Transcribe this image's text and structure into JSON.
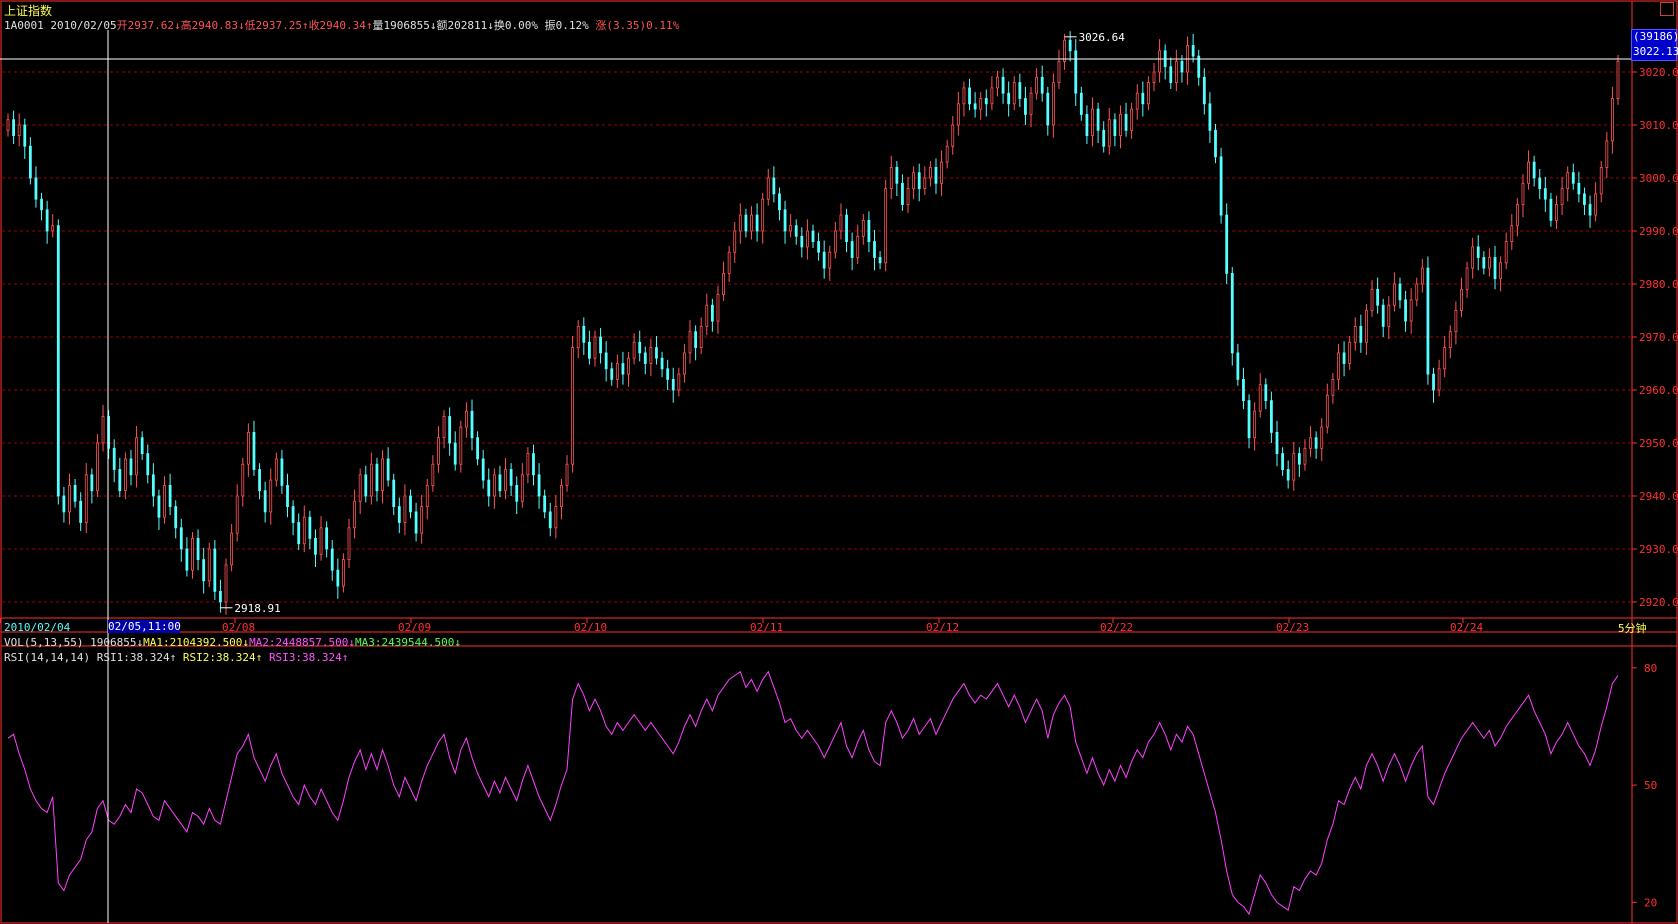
{
  "header": {
    "title": "上证指数",
    "code": "1A0001",
    "date": "2010/02/05",
    "open": "开2937.62↓",
    "high": "高2940.83↓",
    "low": "低2937.25↑",
    "close": "收2940.34↑",
    "volume": "量1906855↓",
    "amount": "额202811↓",
    "turnover": "换0.00%",
    "amplitude": "振0.12%",
    "change": "涨(3.35)0.11%"
  },
  "volume_indicator": {
    "label": "VOL(5,13,55)",
    "value": "1906855↓",
    "ma1": "MA1:2104392.500↓",
    "ma2": "MA2:2448857.500↓",
    "ma3": "MA3:2439544.500↓"
  },
  "rsi_indicator": {
    "label": "RSI(14,14,14)",
    "rsi1": "RSI1:38.324↑",
    "rsi2": "RSI2:38.324↑",
    "rsi3": "RSI3:38.324↑"
  },
  "cursor_label": "02/05,11:00",
  "timeframe": "5分钟",
  "price_tag": {
    "count": "(39186)",
    "price": "3022.13"
  },
  "colors": {
    "up": "#ff5454",
    "down": "#54ffff",
    "grid": "#a00000",
    "axis": "#ff3030",
    "rsi": "#ff40ff",
    "crosshair": "#ffffff",
    "label": "#ffffff"
  },
  "chart_data": [
    {
      "type": "candlestick",
      "title": "",
      "xlabel": "",
      "ylabel": "",
      "ylim": [
        2916,
        3029
      ],
      "yticks": [
        2920.0,
        2930.0,
        2940.0,
        2950.0,
        2960.0,
        2970.0,
        2980.0,
        2990.0,
        3000.0,
        3010.0,
        3020.0
      ],
      "date_labels": [
        "2010/02/04",
        "02/08",
        "02/09",
        "02/10",
        "02/11",
        "02/12",
        "02/22",
        "02/23",
        "02/24"
      ],
      "annotations": [
        {
          "text": "3026.64",
          "value": 3026.64
        },
        {
          "text": "2918.91",
          "value": 2918.91
        }
      ],
      "close": [
        3011,
        3008,
        3010,
        3006,
        3000,
        2996,
        2994,
        2990,
        2991,
        2940,
        2937,
        2942,
        2939,
        2935,
        2944,
        2941,
        2950,
        2955,
        2949,
        2945,
        2941,
        2947,
        2944,
        2951,
        2948,
        2944,
        2940,
        2936,
        2942,
        2938,
        2934,
        2930,
        2926,
        2932,
        2928,
        2924,
        2930,
        2922,
        2920,
        2927,
        2933,
        2940,
        2946,
        2952,
        2945,
        2941,
        2937,
        2943,
        2947,
        2942,
        2938,
        2935,
        2931,
        2936,
        2932,
        2929,
        2934,
        2930,
        2926,
        2923,
        2928,
        2934,
        2939,
        2944,
        2940,
        2946,
        2941,
        2947,
        2943,
        2938,
        2935,
        2940,
        2937,
        2933,
        2938,
        2942,
        2946,
        2951,
        2955,
        2950,
        2946,
        2953,
        2956,
        2951,
        2947,
        2943,
        2940,
        2944,
        2941,
        2945,
        2942,
        2939,
        2944,
        2948,
        2944,
        2940,
        2937,
        2934,
        2938,
        2942,
        2946,
        2968,
        2972,
        2969,
        2966,
        2970,
        2967,
        2964,
        2962,
        2965,
        2963,
        2966,
        2969,
        2967,
        2965,
        2968,
        2966,
        2964,
        2962,
        2960,
        2963,
        2967,
        2971,
        2968,
        2972,
        2976,
        2973,
        2978,
        2982,
        2986,
        2990,
        2993,
        2990,
        2993,
        2990,
        2996,
        3000,
        2997,
        2994,
        2990,
        2991,
        2989,
        2987,
        2990,
        2988,
        2986,
        2983,
        2986,
        2990,
        2993,
        2988,
        2985,
        2989,
        2992,
        2988,
        2985,
        2984,
        2998,
        3002,
        2999,
        2995,
        2998,
        3001,
        2998,
        3000,
        3002,
        2999,
        3003,
        3006,
        3010,
        3014,
        3017,
        3014,
        3013,
        3015,
        3014,
        3017,
        3019,
        3016,
        3014,
        3018,
        3015,
        3012,
        3016,
        3019,
        3016,
        3010,
        3018,
        3022,
        3026,
        3024,
        3016,
        3012,
        3008,
        3013,
        3009,
        3006,
        3011,
        3008,
        3012,
        3009,
        3013,
        3016,
        3014,
        3018,
        3020,
        3024,
        3021,
        3018,
        3022,
        3020,
        3025,
        3023,
        3019,
        3014,
        3009,
        3004,
        2993,
        2982,
        2967,
        2962,
        2958,
        2951,
        2956,
        2961,
        2958,
        2952,
        2948,
        2945,
        2943,
        2948,
        2946,
        2949,
        2951,
        2949,
        2953,
        2959,
        2962,
        2967,
        2965,
        2969,
        2972,
        2969,
        2975,
        2979,
        2976,
        2972,
        2976,
        2980,
        2977,
        2973,
        2977,
        2980,
        2983,
        2963,
        2960,
        2964,
        2968,
        2971,
        2975,
        2979,
        2983,
        2987,
        2985,
        2983,
        2985,
        2981,
        2984,
        2988,
        2991,
        2995,
        2999,
        3003,
        3000,
        2998,
        2996,
        2992,
        2995,
        2998,
        3001,
        2999,
        2997,
        2995,
        2993,
        2997,
        3002,
        3007,
        3015,
        3022
      ]
    },
    {
      "type": "line",
      "title": "",
      "ylim": [
        16,
        82
      ],
      "yticks": [
        20,
        50,
        80
      ],
      "series": [
        {
          "name": "RSI1",
          "values": [
            62,
            63,
            58,
            54,
            49,
            46,
            44,
            43,
            47,
            25,
            23,
            27,
            29,
            31,
            36,
            38,
            44,
            46,
            41,
            40,
            42,
            45,
            43,
            49,
            48,
            45,
            42,
            41,
            46,
            44,
            42,
            40,
            38,
            43,
            42,
            40,
            44,
            41,
            40,
            46,
            52,
            58,
            60,
            63,
            57,
            54,
            51,
            55,
            58,
            53,
            50,
            47,
            45,
            50,
            47,
            45,
            49,
            46,
            43,
            41,
            46,
            52,
            56,
            59,
            54,
            58,
            54,
            59,
            55,
            50,
            47,
            52,
            49,
            46,
            51,
            55,
            58,
            61,
            63,
            57,
            53,
            59,
            62,
            57,
            53,
            50,
            47,
            51,
            48,
            52,
            49,
            46,
            51,
            55,
            51,
            47,
            44,
            41,
            45,
            50,
            54,
            72,
            76,
            73,
            69,
            72,
            69,
            65,
            63,
            66,
            64,
            66,
            68,
            66,
            64,
            66,
            64,
            62,
            60,
            58,
            61,
            65,
            68,
            65,
            69,
            72,
            69,
            73,
            75,
            77,
            78,
            79,
            75,
            77,
            74,
            77,
            79,
            75,
            71,
            66,
            67,
            64,
            62,
            64,
            62,
            60,
            57,
            60,
            63,
            66,
            60,
            57,
            61,
            64,
            59,
            56,
            55,
            66,
            69,
            66,
            62,
            64,
            67,
            63,
            65,
            67,
            63,
            66,
            69,
            72,
            74,
            76,
            73,
            71,
            73,
            72,
            74,
            76,
            73,
            70,
            73,
            70,
            66,
            69,
            72,
            69,
            62,
            68,
            71,
            73,
            70,
            61,
            57,
            53,
            57,
            53,
            50,
            54,
            51,
            55,
            52,
            56,
            59,
            57,
            61,
            63,
            66,
            63,
            59,
            63,
            61,
            65,
            63,
            58,
            53,
            48,
            43,
            36,
            28,
            22,
            20,
            19,
            17,
            22,
            27,
            25,
            22,
            20,
            19,
            18,
            24,
            23,
            26,
            28,
            27,
            30,
            36,
            40,
            46,
            45,
            49,
            52,
            49,
            55,
            58,
            55,
            51,
            55,
            58,
            55,
            51,
            55,
            58,
            60,
            47,
            45,
            49,
            53,
            56,
            59,
            62,
            64,
            66,
            64,
            62,
            64,
            60,
            62,
            65,
            67,
            69,
            71,
            73,
            69,
            66,
            63,
            58,
            61,
            63,
            66,
            63,
            60,
            58,
            55,
            59,
            65,
            70,
            76,
            78
          ]
        }
      ]
    }
  ]
}
